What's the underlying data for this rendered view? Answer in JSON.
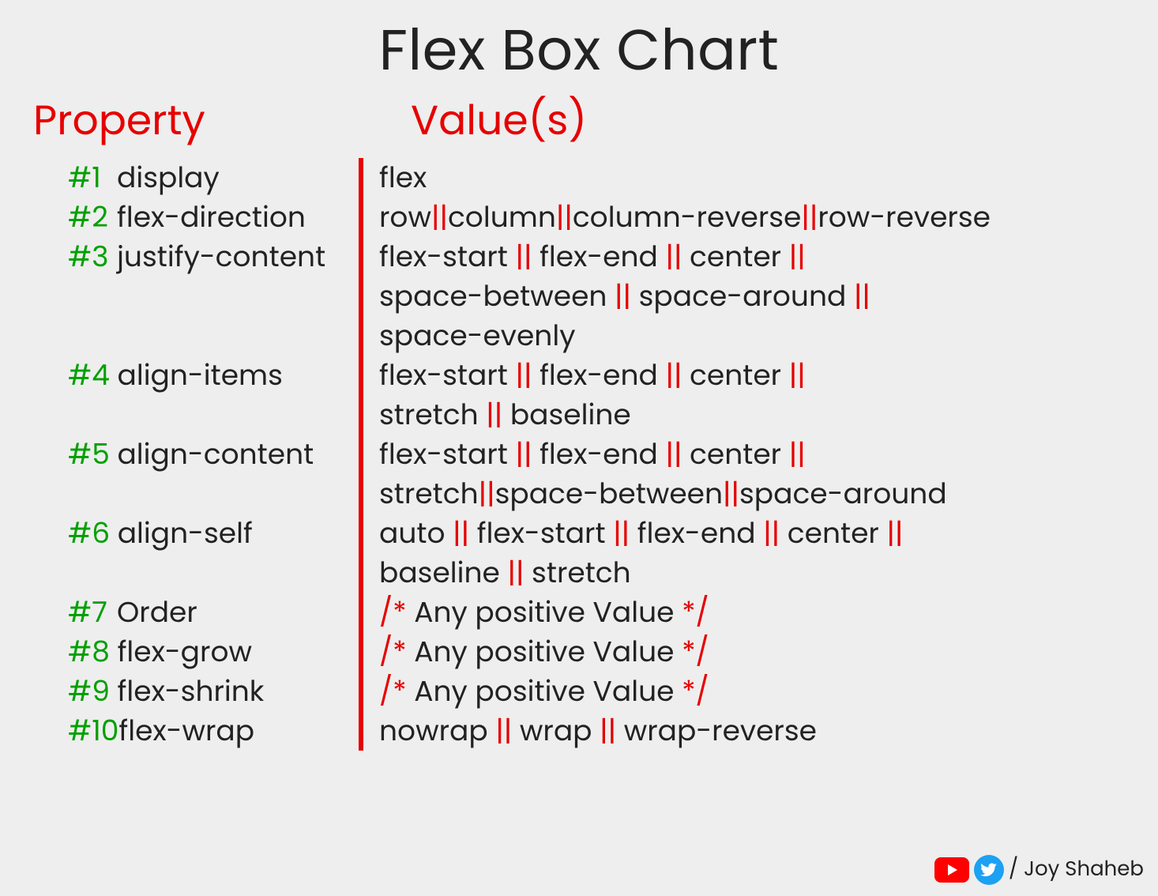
{
  "title": "Flex Box Chart",
  "headings": {
    "property": "Property",
    "values": "Value(s)"
  },
  "separator": "||",
  "chart_data": {
    "type": "table",
    "title": "Flex Box Chart",
    "columns": [
      "Property",
      "Value(s)"
    ],
    "rows": [
      {
        "n": "#1",
        "property": "display",
        "values": [
          "flex"
        ]
      },
      {
        "n": "#2",
        "property": "flex-direction",
        "values": [
          "row",
          "column",
          "column-reverse",
          "row-reverse"
        ],
        "compact": true
      },
      {
        "n": "#3",
        "property": "justify-content",
        "values_lines": [
          [
            "flex-start",
            "flex-end",
            "center"
          ],
          [
            "space-between",
            "space-around"
          ],
          [
            "space-evenly"
          ]
        ],
        "trailing_sep_lines": [
          true,
          true,
          false
        ]
      },
      {
        "n": "#4",
        "property": "align-items",
        "values_lines": [
          [
            "flex-start",
            "flex-end",
            "center"
          ],
          [
            "stretch",
            "baseline"
          ]
        ],
        "trailing_sep_lines": [
          true,
          false
        ]
      },
      {
        "n": "#5",
        "property": "align-content",
        "values_lines": [
          [
            "flex-start",
            "flex-end",
            "center"
          ],
          [
            "stretch",
            "space-between",
            "space-around"
          ]
        ],
        "trailing_sep_lines": [
          true,
          false
        ],
        "compact_lines": [
          false,
          true
        ]
      },
      {
        "n": "#6",
        "property": "align-self",
        "values_lines": [
          [
            "auto",
            "flex-start",
            "flex-end",
            "center"
          ],
          [
            "baseline",
            "stretch"
          ]
        ],
        "trailing_sep_lines": [
          true,
          false
        ]
      },
      {
        "n": "#7",
        "property": "Order",
        "comment": "Any positive Value"
      },
      {
        "n": "#8",
        "property": "flex-grow",
        "comment": "Any positive Value"
      },
      {
        "n": "#9",
        "property": "flex-shrink",
        "comment": "Any positive Value"
      },
      {
        "n": "#10",
        "property": "flex-wrap",
        "values": [
          "nowrap",
          "wrap",
          "wrap-reverse"
        ]
      }
    ]
  },
  "credit": {
    "text": "/ Joy Shaheb",
    "icons": [
      "youtube",
      "twitter"
    ]
  }
}
